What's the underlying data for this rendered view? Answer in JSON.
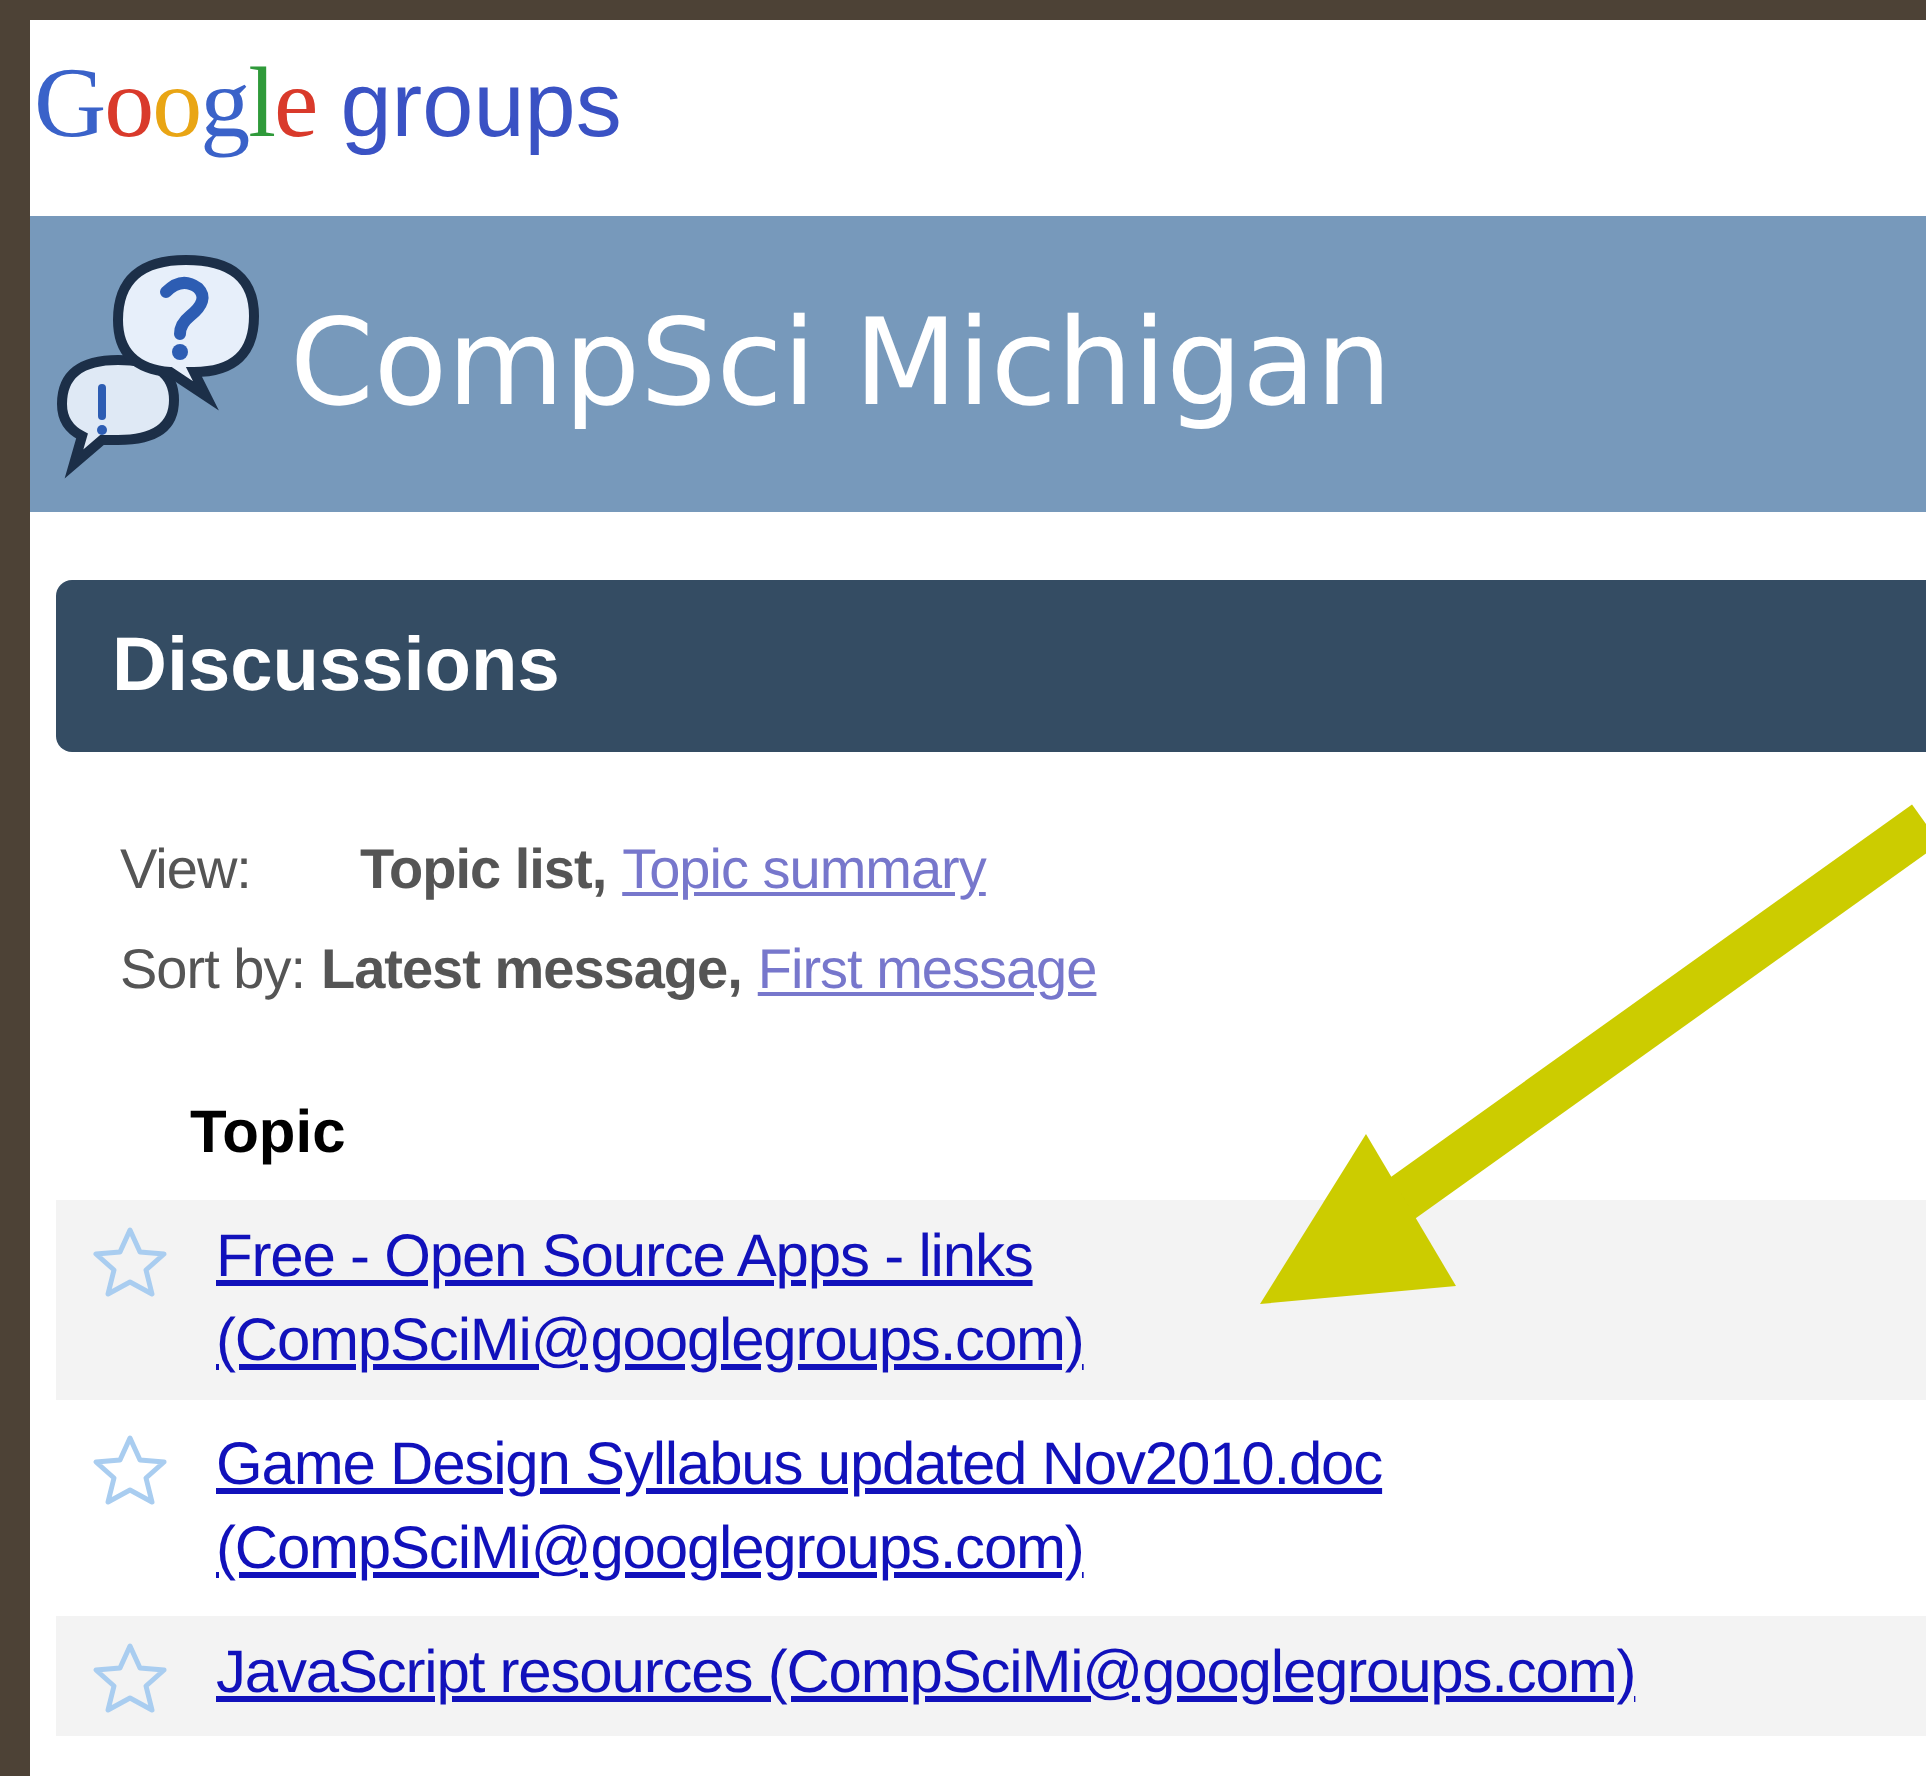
{
  "logo": {
    "letters": [
      {
        "text": "G",
        "color": "#3a62c9"
      },
      {
        "text": "o",
        "color": "#d93a2b"
      },
      {
        "text": "o",
        "color": "#e9a514"
      },
      {
        "text": "g",
        "color": "#3a62c9"
      },
      {
        "text": "l",
        "color": "#2f9a3a"
      },
      {
        "text": "e",
        "color": "#d93a2b"
      }
    ],
    "product": "groups"
  },
  "group": {
    "title": "CompSci Michigan"
  },
  "section": {
    "title": "Discussions"
  },
  "view": {
    "label": "View:",
    "options": [
      {
        "text": "Topic list,",
        "selected": true
      },
      {
        "text": "Topic summary",
        "selected": false
      }
    ]
  },
  "sort": {
    "label": "Sort by:",
    "options": [
      {
        "text": "Latest message,",
        "selected": true
      },
      {
        "text": "First message",
        "selected": false
      }
    ]
  },
  "table": {
    "column": "Topic",
    "rows": [
      {
        "starred": false,
        "lines": [
          "Free - Open Source Apps - links",
          "(CompSciMi@googlegroups.com)"
        ]
      },
      {
        "starred": false,
        "lines": [
          "Game Design Syllabus updated Nov2010.doc",
          "(CompSciMi@googlegroups.com)"
        ]
      },
      {
        "starred": false,
        "lines": [
          "JavaScript resources (CompSciMi@googlegroups.com)"
        ]
      }
    ]
  },
  "annotation": {
    "kind": "arrow"
  }
}
